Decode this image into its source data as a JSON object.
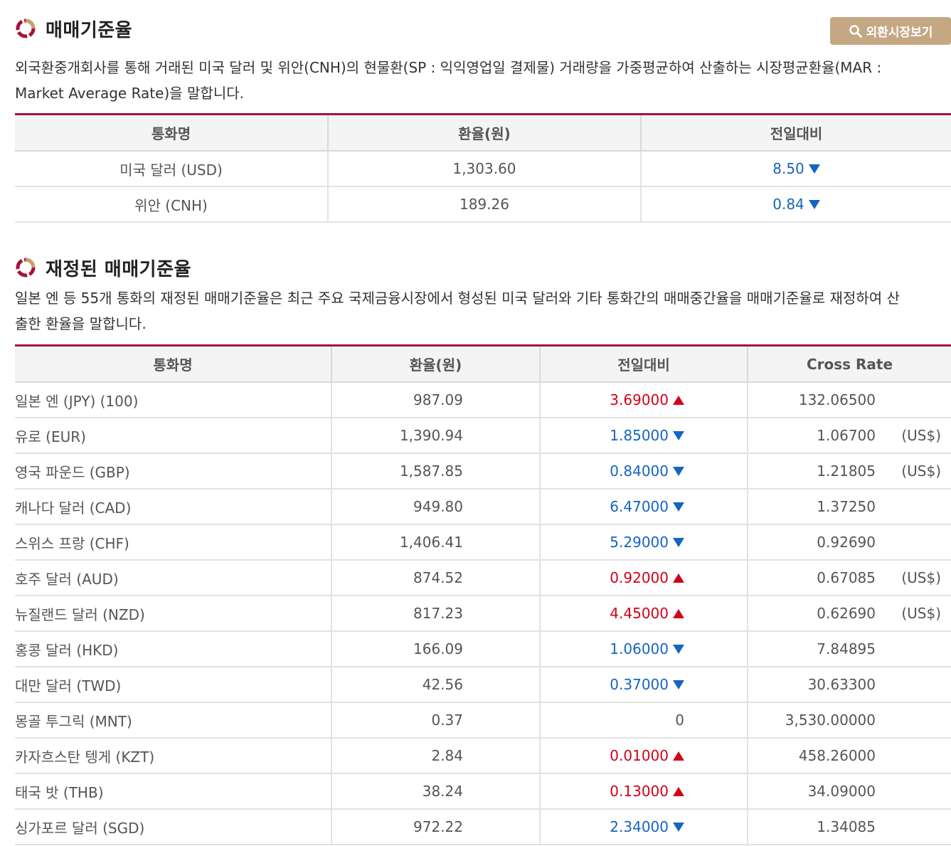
{
  "section1": {
    "title": "매매기준율",
    "button_label": "외환시장보기",
    "desc_line1": "외국환중개회사를 통해 거래된 미국 달러 및 위안(CNH)의 현물환(SP : 익익영업일 결제물) 거래량을 가중평균하여 산출하는 시장평균환율(MAR :",
    "desc_line2": "Market Average Rate)을 말합니다.",
    "headers": [
      "통화명",
      "환율(원)",
      "전일대비"
    ],
    "rows": [
      {
        "name": "미국 달러 (USD)",
        "rate": "1,303.60",
        "change": "8.50",
        "direction": "down"
      },
      {
        "name": "위안 (CNH)",
        "rate": "189.26",
        "change": "0.84",
        "direction": "down"
      }
    ]
  },
  "section2": {
    "title": "재정된 매매기준율",
    "desc_line1": "일본 엔 등 55개 통화의 재정된 매매기준율은 최근 주요 국제금융시장에서 형성된 미국 달러와 기타 통화간의 매매중간율을 매매기준율로 재정하여 산",
    "desc_line2": "출한 환율을 말합니다.",
    "headers": [
      "통화명",
      "환율(원)",
      "전일대비",
      "Cross Rate"
    ],
    "rows": [
      {
        "name": "일본 엔 (JPY) (100)",
        "rate": "987.09",
        "change": "3.69000",
        "direction": "up",
        "cross": "132.06500",
        "unit": ""
      },
      {
        "name": "유로 (EUR)",
        "rate": "1,390.94",
        "change": "1.85000",
        "direction": "down",
        "cross": "1.06700",
        "unit": "(US$)"
      },
      {
        "name": "영국 파운드 (GBP)",
        "rate": "1,587.85",
        "change": "0.84000",
        "direction": "down",
        "cross": "1.21805",
        "unit": "(US$)"
      },
      {
        "name": "캐나다 달러 (CAD)",
        "rate": "949.80",
        "change": "6.47000",
        "direction": "down",
        "cross": "1.37250",
        "unit": ""
      },
      {
        "name": "스위스 프랑 (CHF)",
        "rate": "1,406.41",
        "change": "5.29000",
        "direction": "down",
        "cross": "0.92690",
        "unit": ""
      },
      {
        "name": "호주 달러 (AUD)",
        "rate": "874.52",
        "change": "0.92000",
        "direction": "up",
        "cross": "0.67085",
        "unit": "(US$)"
      },
      {
        "name": "뉴질랜드 달러 (NZD)",
        "rate": "817.23",
        "change": "4.45000",
        "direction": "up",
        "cross": "0.62690",
        "unit": "(US$)"
      },
      {
        "name": "홍콩 달러 (HKD)",
        "rate": "166.09",
        "change": "1.06000",
        "direction": "down",
        "cross": "7.84895",
        "unit": ""
      },
      {
        "name": "대만 달러 (TWD)",
        "rate": "42.56",
        "change": "0.37000",
        "direction": "down",
        "cross": "30.63300",
        "unit": ""
      },
      {
        "name": "몽골 투그릭 (MNT)",
        "rate": "0.37",
        "change": "0",
        "direction": "flat",
        "cross": "3,530.00000",
        "unit": ""
      },
      {
        "name": "카자흐스탄 텡게 (KZT)",
        "rate": "2.84",
        "change": "0.01000",
        "direction": "up",
        "cross": "458.26000",
        "unit": ""
      },
      {
        "name": "태국 밧 (THB)",
        "rate": "38.24",
        "change": "0.13000",
        "direction": "up",
        "cross": "34.09000",
        "unit": ""
      },
      {
        "name": "싱가포르 달러 (SGD)",
        "rate": "972.22",
        "change": "2.34000",
        "direction": "down",
        "cross": "1.34085",
        "unit": ""
      }
    ]
  },
  "colors": {
    "accent": "#a6123a",
    "button_bg": "#c5a883",
    "down": "#1565c0",
    "up": "#d0021b",
    "icon_gold": "#c5a06a"
  },
  "icons": {
    "section_title": "circle-segments-icon",
    "button": "search-icon",
    "down": "triangle-down-icon",
    "up": "triangle-up-icon"
  }
}
